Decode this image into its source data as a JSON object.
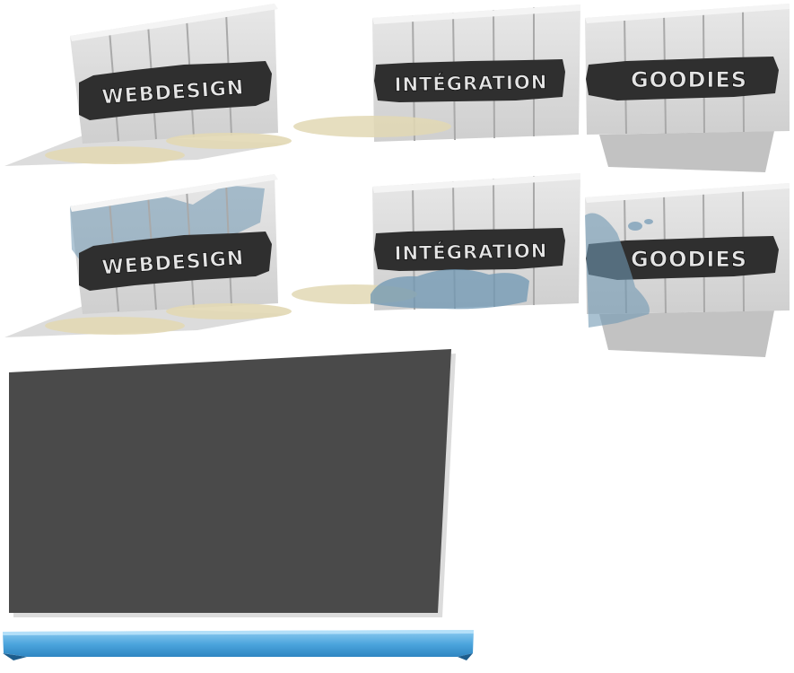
{
  "buttons": {
    "row1": {
      "webdesign": "WEBDESIGN",
      "integration": "INTÉGRATION",
      "goodies": "GOODIES"
    },
    "row2": {
      "webdesign": "WEBDESIGN",
      "integration": "INTÉGRATION",
      "goodies": "GOODIES"
    }
  },
  "colors": {
    "fence": "#dcdcdc",
    "plank_line": "#b5b5b5",
    "banner": "#2f2f2f",
    "label": "#e4e4e4",
    "puddle_sand": "#e2d8b4",
    "puddle_water": "#6f97b3",
    "shadow": "#c4c4c4",
    "dark_panel": "#4a4a4a",
    "blue_bar": "#4aa3dc"
  }
}
